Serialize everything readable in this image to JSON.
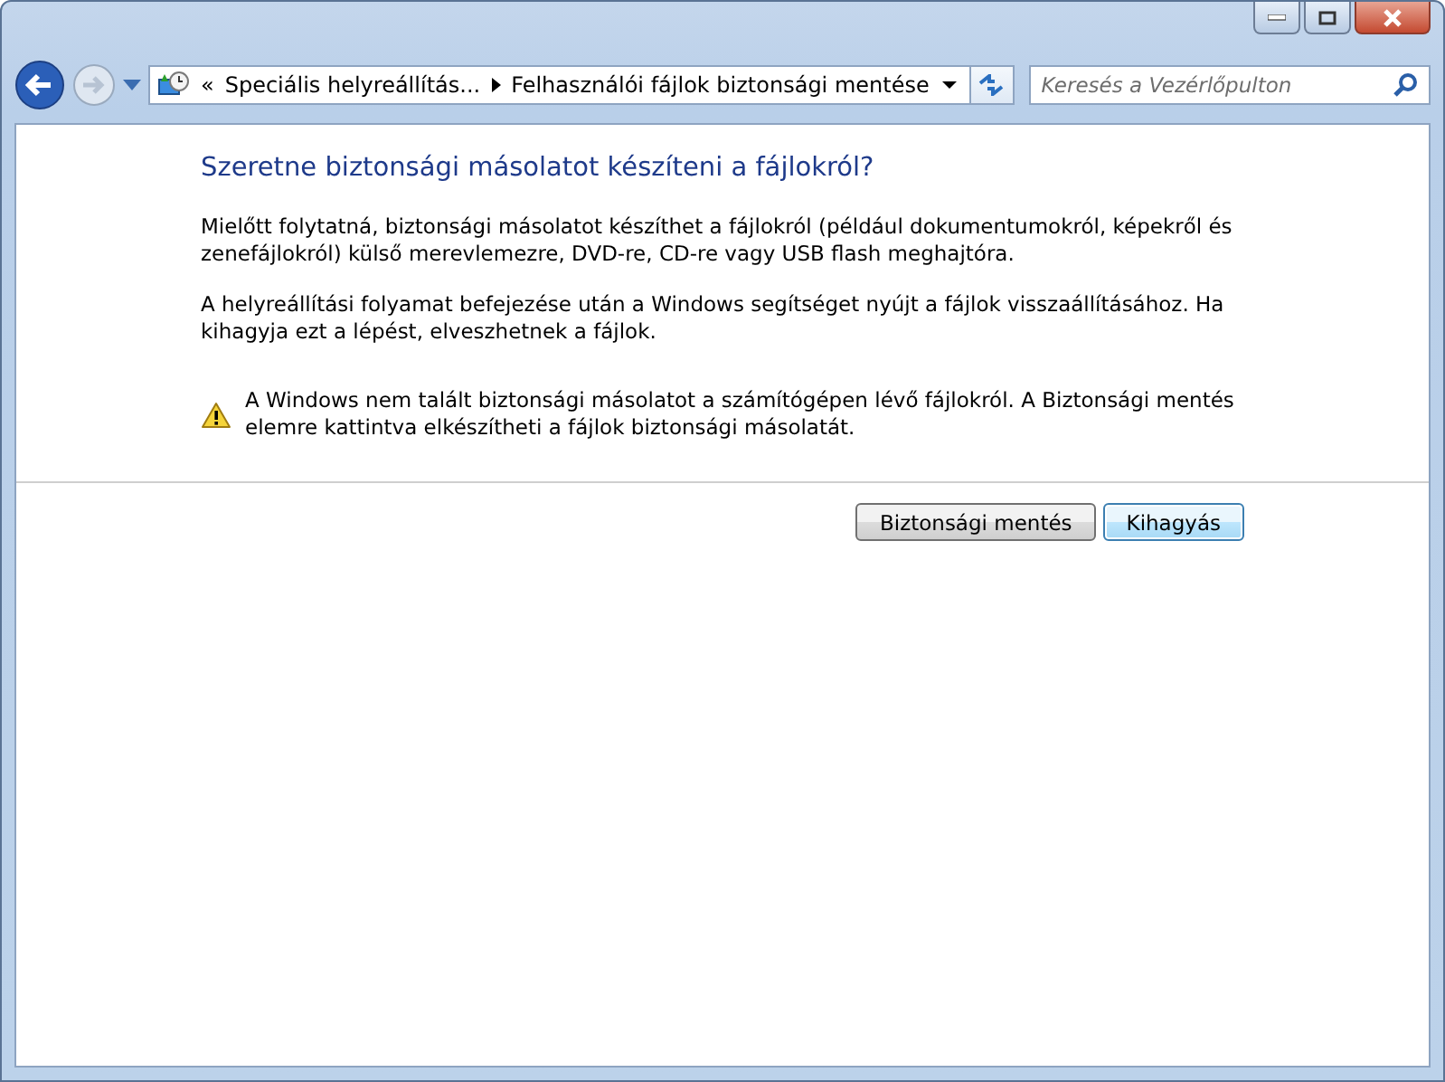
{
  "address_bar": {
    "overflow": "«",
    "crumbs": [
      "Speciális helyreállítás...",
      "Felhasználói fájlok biztonsági mentése"
    ]
  },
  "search": {
    "placeholder": "Keresés a Vezérlőpulton"
  },
  "heading": "Szeretne biztonsági másolatot készíteni a fájlokról?",
  "paragraphs": [
    "Mielőtt folytatná, biztonsági másolatot készíthet a fájlokról (például dokumentumokról, képekről és zenefájlokról) külső merevlemezre, DVD-re, CD-re vagy USB flash meghajtóra.",
    "A helyreállítási folyamat befejezése után a Windows segítséget nyújt a fájlok visszaállításához. Ha kihagyja ezt a lépést, elveszhetnek a fájlok."
  ],
  "warning": "A Windows nem talált biztonsági másolatot a számítógépen lévő fájlokról. A Biztonsági mentés elemre kattintva elkészítheti a fájlok biztonsági másolatát.",
  "buttons": [
    {
      "label": "Biztonsági mentés",
      "selected": false
    },
    {
      "label": "Kihagyás",
      "selected": true
    }
  ]
}
